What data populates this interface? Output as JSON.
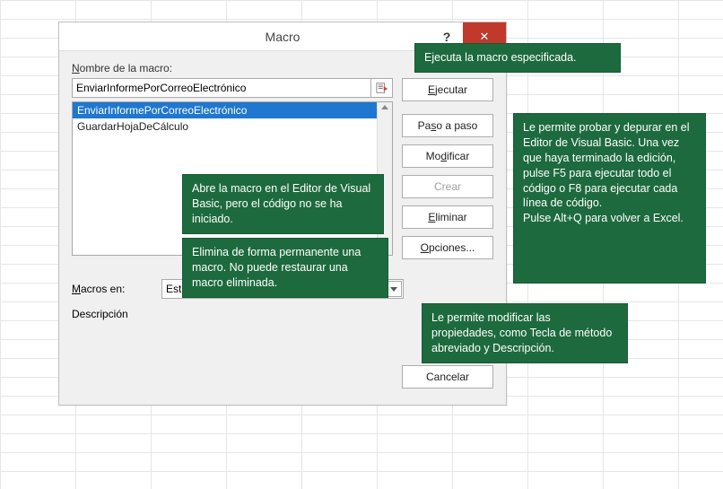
{
  "dialog": {
    "title": "Macro",
    "name_label_pre": "N",
    "name_label_rest": "ombre de la macro:",
    "name_value": "EnviarInformePorCorreoElectrónico",
    "list": [
      "EnviarInformePorCorreoElectrónico",
      "GuardarHojaDeCálculo"
    ],
    "selected_index": 0,
    "buttons": {
      "run_u": "E",
      "run_rest": "jecutar",
      "step_pre": "Pa",
      "step_u": "s",
      "step_rest": "o a paso",
      "edit_pre": "Mo",
      "edit_u": "d",
      "edit_rest": "ificar",
      "create": "Crear",
      "delete_u": "E",
      "delete_rest": "liminar",
      "options_u": "O",
      "options_rest": "pciones...",
      "cancel": "Cancelar"
    },
    "macros_in_u": "M",
    "macros_in_rest": "acros en:",
    "macros_in_value": "Este libro",
    "description_label": "Descripción"
  },
  "callouts": {
    "top": "Ejecuta la macro especificada.",
    "step": "Le permite probar y depurar en el Editor de Visual Basic. Una vez que haya terminado la edición, pulse F5 para ejecutar todo el código o F8 para ejecutar cada línea de código.\nPulse Alt+Q para volver a Excel.",
    "modify": "Abre la macro en el Editor de Visual Basic, pero el código no se ha iniciado.",
    "delete": "Elimina de forma permanente una macro. No puede restaurar una macro eliminada.",
    "options": "Le permite modificar las propiedades, como Tecla de método abreviado y Descripción."
  },
  "icons": {
    "run_macro": "run-macro-icon"
  }
}
